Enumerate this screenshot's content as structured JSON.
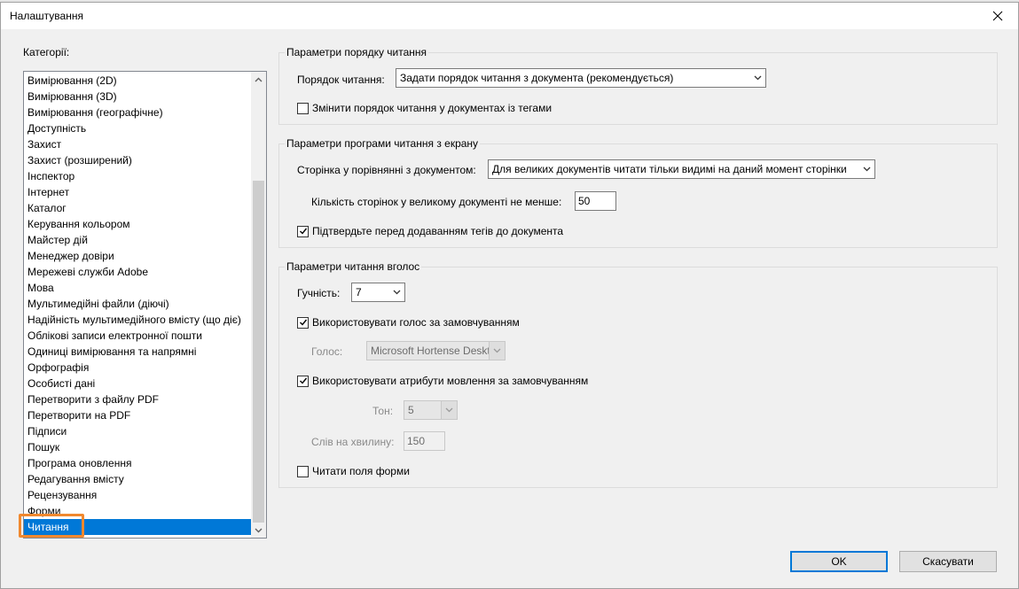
{
  "window": {
    "title": "Налаштування",
    "close_icon": "close-icon"
  },
  "categories": {
    "label": "Категорії:",
    "items": [
      "Вимірювання (2D)",
      "Вимірювання (3D)",
      "Вимірювання (географічне)",
      "Доступність",
      "Захист",
      "Захист (розширений)",
      "Інспектор",
      "Інтернет",
      "Каталог",
      "Керування кольором",
      "Майстер дій",
      "Менеджер довіри",
      "Мережеві служби Adobe",
      "Мова",
      "Мультимедійні файли (діючі)",
      "Надійність мультимедійного вмісту (що діє)",
      "Облікові записи електронної пошти",
      "Одиниці вимірювання та напрямні",
      "Орфографія",
      "Особисті дані",
      "Перетворити з файлу PDF",
      "Перетворити на PDF",
      "Підписи",
      "Пошук",
      "Програма оновлення",
      "Редагування вмісту",
      "Рецензування",
      "Форми",
      "Читання"
    ],
    "selected": "Читання"
  },
  "reading_order": {
    "title": "Параметри порядку читання",
    "order_label": "Порядок читання:",
    "order_value": "Задати порядок читання з документа (рекомендується)",
    "override_label": "Змінити порядок читання у документах із тегами",
    "override_checked": false
  },
  "screen_reader": {
    "title": "Параметри програми читання з екрану",
    "page_vs_doc_label": "Сторінка у порівнянні з документом:",
    "page_vs_doc_value": "Для великих документів читати тільки видимі на даний момент сторінки",
    "min_pages_label": "Кількість сторінок у великому документі не менше:",
    "min_pages_value": "50",
    "confirm_tags_label": "Підтвердьте перед додаванням тегів до документа",
    "confirm_tags_checked": true
  },
  "read_aloud": {
    "title": "Параметри читання вголос",
    "volume_label": "Гучність:",
    "volume_value": "7",
    "default_voice_label": "Використовувати голос за замовчуванням",
    "default_voice_checked": true,
    "voice_label": "Голос:",
    "voice_value": "Microsoft Hortense Desktop",
    "default_attr_label": "Використовувати атрибути мовлення за замовчуванням",
    "default_attr_checked": true,
    "pitch_label": "Тон:",
    "pitch_value": "5",
    "wpm_label": "Слів на хвилину:",
    "wpm_value": "150",
    "read_forms_label": "Читати поля форми",
    "read_forms_checked": false
  },
  "buttons": {
    "ok": "OK",
    "cancel": "Скасувати"
  },
  "colors": {
    "selection": "#0078d7",
    "highlight": "#f0882e",
    "dialog_bg": "#f0f0f0"
  }
}
